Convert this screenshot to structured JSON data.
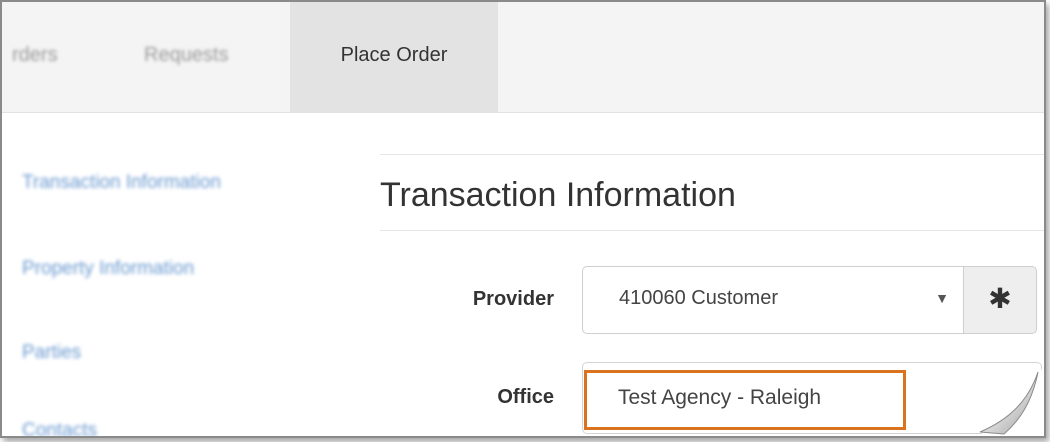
{
  "nav": {
    "tabs": [
      {
        "label": "rders"
      },
      {
        "label": "Requests"
      },
      {
        "label": "Place Order"
      }
    ]
  },
  "sidebar": {
    "items": [
      {
        "label": "Transaction Information"
      },
      {
        "label": "Property Information"
      },
      {
        "label": "Parties"
      },
      {
        "label": "Contacts"
      }
    ]
  },
  "main": {
    "title": "Transaction Information",
    "provider": {
      "label": "Provider",
      "value": "410060 Customer",
      "caret": "▼",
      "addon_icon": "asterisk-icon",
      "addon_glyph": "✱"
    },
    "office": {
      "label": "Office",
      "value": "Test Agency - Raleigh"
    }
  },
  "colors": {
    "highlight": "#d9731f",
    "link": "#6b9ad0",
    "active_tab_bg": "#e3e3e3"
  }
}
